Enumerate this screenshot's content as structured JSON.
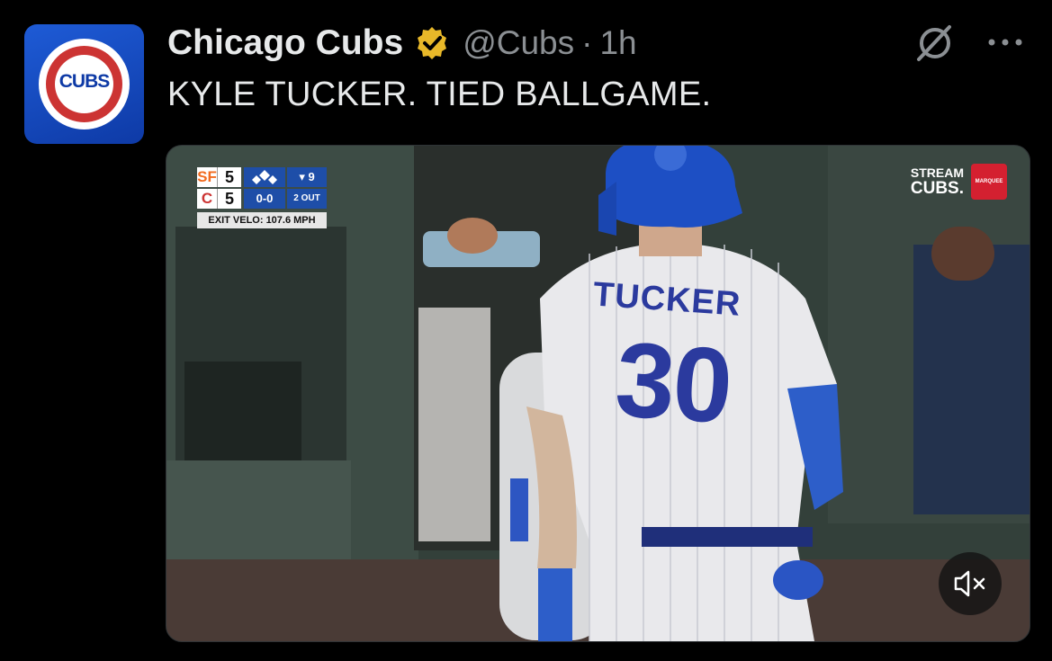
{
  "tweet": {
    "author_name": "Chicago Cubs",
    "handle": "@Cubs",
    "separator": "·",
    "time": "1h",
    "text": "KYLE TUCKER. TIED BALLGAME.",
    "avatar_logo_text": "CUBS"
  },
  "video": {
    "scorebug": {
      "away_team": "SF",
      "away_score": "5",
      "home_team": "C",
      "home_score": "5",
      "inning": "▾ 9",
      "count": "0-0",
      "outs": "2 OUT",
      "exit_velo": "EXIT VELO: 107.6 MPH"
    },
    "broadcaster_line1": "STREAM",
    "broadcaster_line2": "CUBS.",
    "broadcaster_badge": "MARQUEE",
    "jersey_name": "TUCKER",
    "jersey_number": "30",
    "muted": true
  },
  "colors": {
    "background": "#000000",
    "text_primary": "#e7e9ea",
    "text_secondary": "#8b8f93",
    "verified_gold": "#e8b829",
    "cubs_blue": "#0e3aa6",
    "cubs_red": "#cc3433"
  },
  "icons": {
    "verified": "gold-verified-badge-icon",
    "grok": "grok-icon",
    "more": "more-dots-icon",
    "mute": "speaker-muted-icon"
  }
}
